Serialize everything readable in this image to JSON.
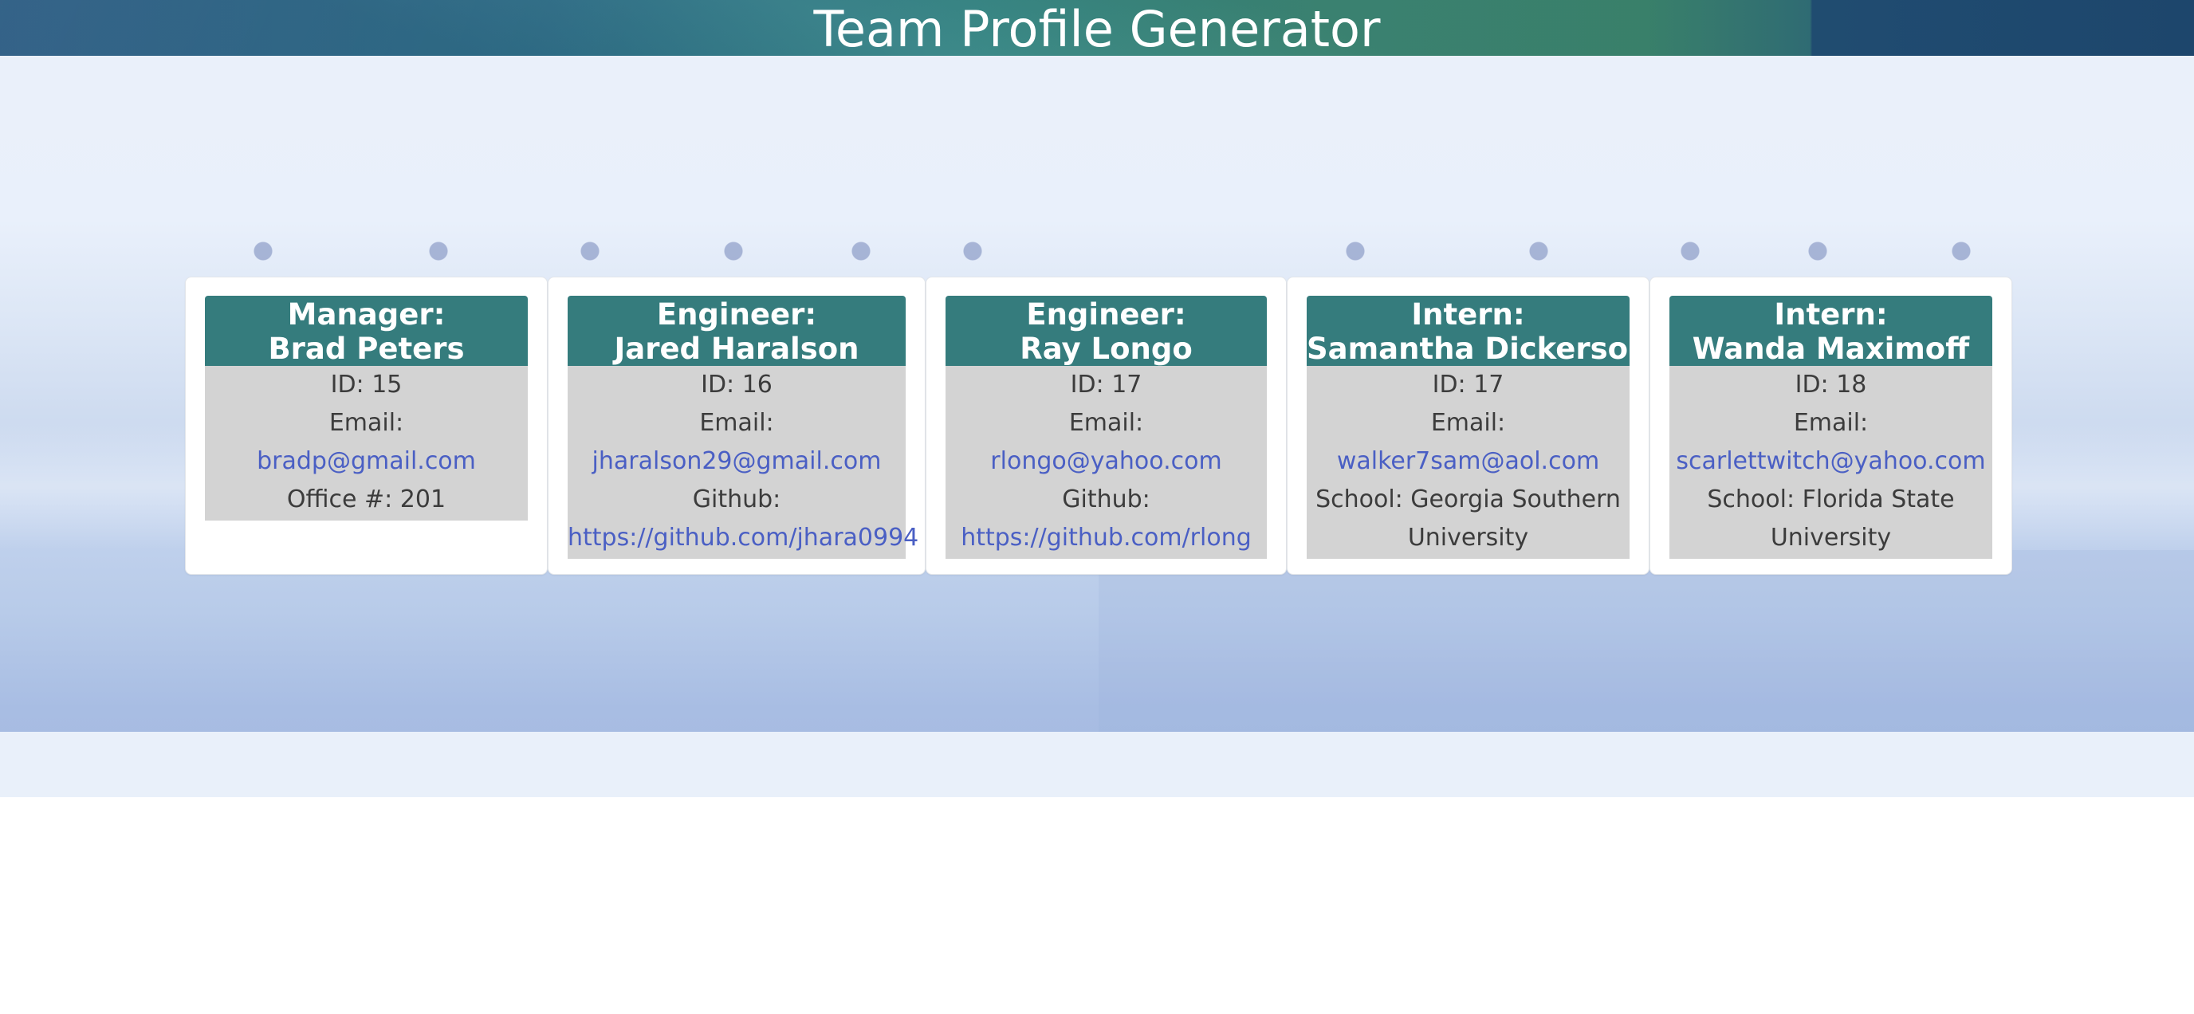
{
  "header": {
    "title": "Team Profile Generator"
  },
  "colors": {
    "header_bg": "#2c6c86",
    "card_head_bg": "#357c7d",
    "card_body_bg": "#d3d3d3",
    "link": "#4a5fc4"
  },
  "cards": [
    {
      "role": "Manager:",
      "name": "Brad Peters",
      "id_text": "ID: 15",
      "email_label": "Email:",
      "email": "bradp@gmail.com",
      "extra_text": "Office #: 201"
    },
    {
      "role": "Engineer:",
      "name": "Jared Haralson",
      "id_text": "ID: 16",
      "email_label": "Email:",
      "email": "jharalson29@gmail.com",
      "github_label": "Github:",
      "github": "https://github.com/jhara0994"
    },
    {
      "role": "Engineer:",
      "name": "Ray Longo",
      "id_text": "ID: 17",
      "email_label": "Email:",
      "email": "rlongo@yahoo.com",
      "github_label": "Github:",
      "github": "https://github.com/rlong"
    },
    {
      "role": "Intern:",
      "name": "Samantha Dickerson",
      "id_text": "ID: 17",
      "email_label": "Email:",
      "email": "walker7sam@aol.com",
      "school_text": "School: Georgia Southern University"
    },
    {
      "role": "Intern:",
      "name": "Wanda Maximoff",
      "id_text": "ID: 18",
      "email_label": "Email:",
      "email": "scarlettwitch@yahoo.com",
      "school_text": "School: Florida State University"
    }
  ]
}
